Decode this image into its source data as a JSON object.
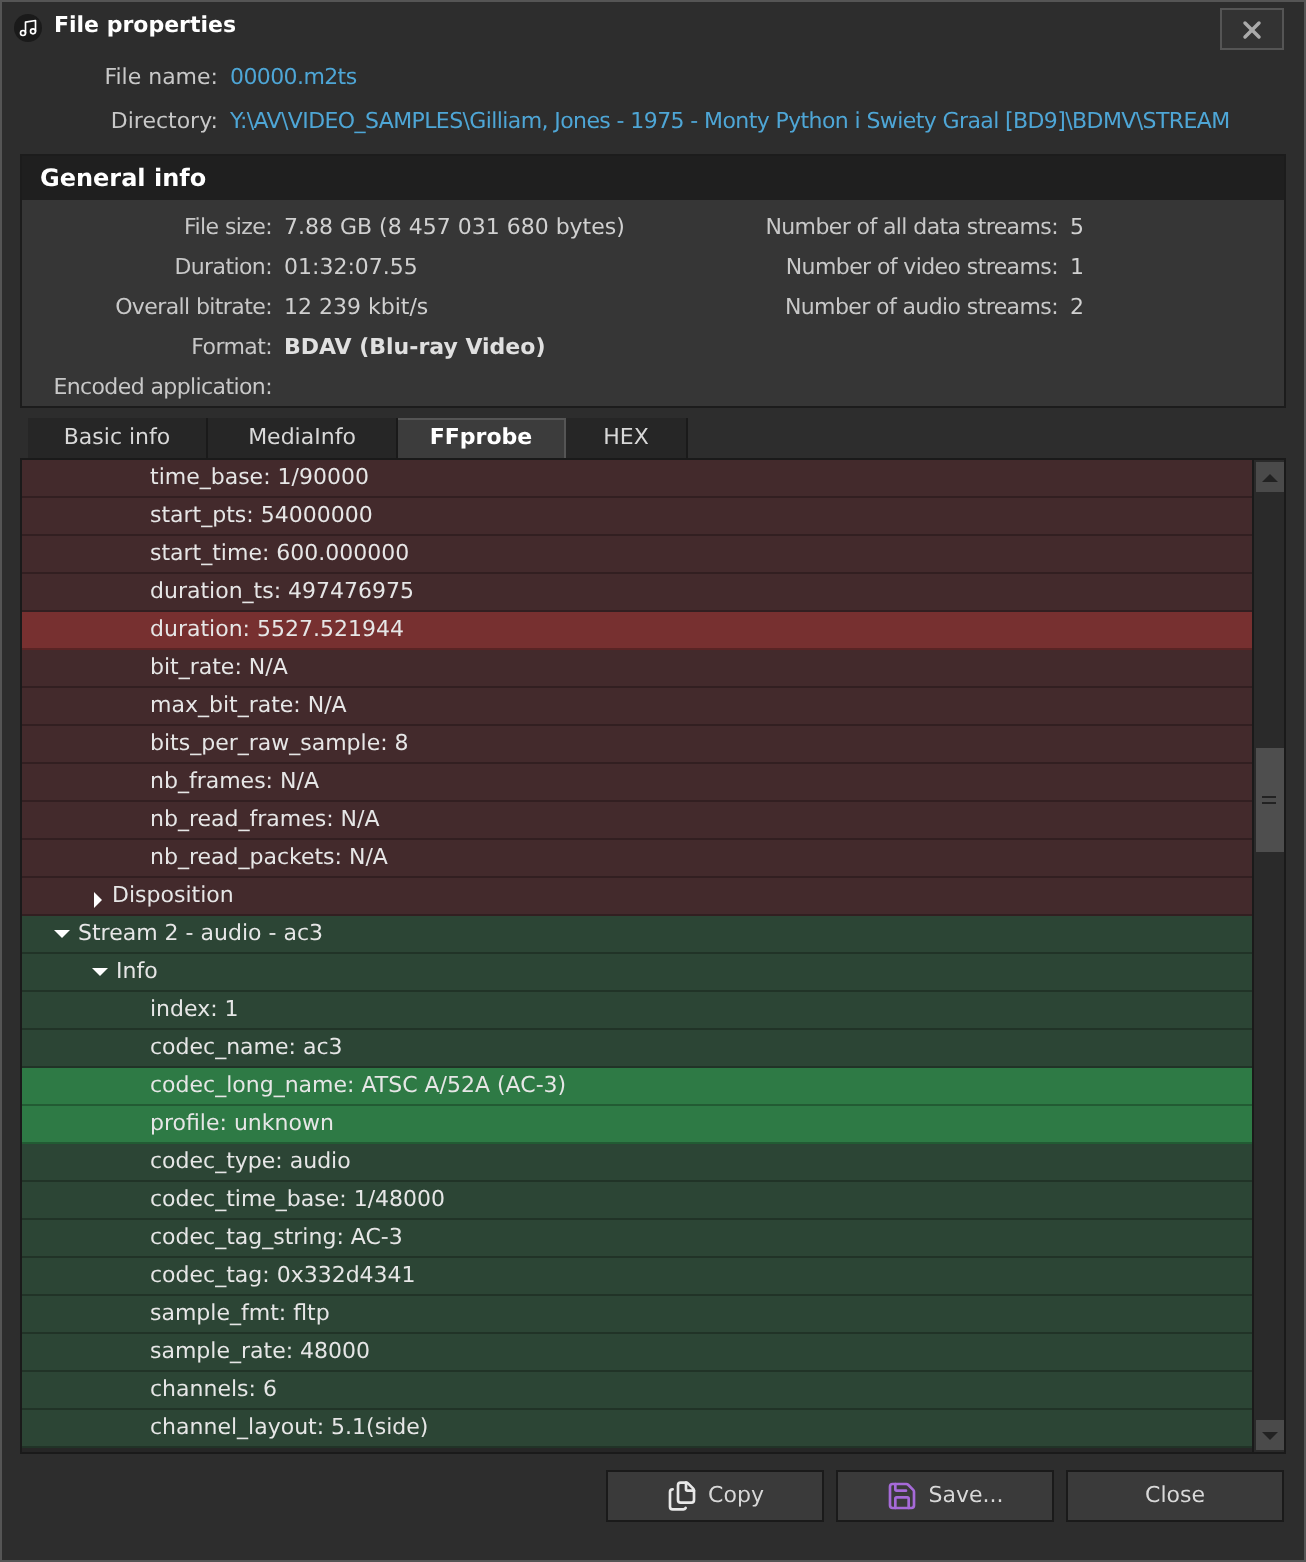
{
  "window": {
    "title": "File properties"
  },
  "file": [
    {
      "label": "File name:",
      "value": "00000.m2ts"
    },
    {
      "label": "Directory:",
      "value": "Y:\\AV\\VIDEO_SAMPLES\\Gilliam, Jones - 1975 - Monty Python i Swiety Graal [BD9]\\BDMV\\STREAM"
    }
  ],
  "general_info": {
    "title": "General info",
    "left": [
      {
        "label": "File size:",
        "value": "7.88 GB (8 457 031 680 bytes)",
        "bold": false
      },
      {
        "label": "Duration:",
        "value": "01:32:07.55",
        "bold": false
      },
      {
        "label": "Overall bitrate:",
        "value": "12 239 kbit/s",
        "bold": false
      },
      {
        "label": "Format:",
        "value": "BDAV (Blu-ray Video)",
        "bold": true
      },
      {
        "label": "Encoded application:"
      }
    ],
    "right": [
      {
        "label": "Number of all data streams:",
        "value": "5"
      },
      {
        "label": "Number of video streams:",
        "value": "1"
      },
      {
        "label": "Number of audio streams:",
        "value": "2"
      }
    ]
  },
  "tabs": [
    {
      "label": "Basic info",
      "selected": false
    },
    {
      "label": "MediaInfo",
      "selected": false
    },
    {
      "label": "FFprobe",
      "selected": true
    },
    {
      "label": "HEX",
      "selected": false
    }
  ],
  "tree": [
    {
      "color": "#432a2c",
      "children": [
        {
          "children": [
            {
              "label": "time_base: 1/90000",
              "selected": false
            },
            {
              "label": "start_pts: 54000000",
              "selected": false
            },
            {
              "label": "start_time: 600.000000",
              "selected": false
            },
            {
              "label": "duration_ts: 497476975",
              "selected": false
            },
            {
              "label": "duration: 5527.521944",
              "selected": true
            },
            {
              "label": "bit_rate: N/A",
              "selected": false
            },
            {
              "label": "max_bit_rate: N/A",
              "selected": false
            },
            {
              "label": "bits_per_raw_sample: 8",
              "selected": false
            },
            {
              "label": "nb_frames: N/A",
              "selected": false
            },
            {
              "label": "nb_read_frames: N/A",
              "selected": false
            },
            {
              "label": "nb_read_packets: N/A",
              "selected": false
            }
          ]
        },
        {
          "label": "Disposition",
          "expanded": false,
          "selected": false
        }
      ]
    },
    {
      "label": "Stream 2 - audio - ac3",
      "expanded": true,
      "selected": false,
      "color": "#2c4535",
      "children": [
        {
          "label": "Info",
          "expanded": true,
          "selected": false,
          "children": [
            {
              "label": "index: 1",
              "selected": false
            },
            {
              "label": "codec_name: ac3",
              "selected": false
            },
            {
              "label": "codec_long_name: ATSC A/52A (AC-3)",
              "selected": true
            },
            {
              "label": "profile: unknown",
              "selected": true
            },
            {
              "label": "codec_type: audio",
              "selected": false
            },
            {
              "label": "codec_time_base: 1/48000",
              "selected": false
            },
            {
              "label": "codec_tag_string: AC-3",
              "selected": false
            },
            {
              "label": "codec_tag: 0x332d4341",
              "selected": false
            },
            {
              "label": "sample_fmt: fltp",
              "selected": false
            },
            {
              "label": "sample_rate: 48000",
              "selected": false
            },
            {
              "label": "channels: 6",
              "selected": false
            },
            {
              "label": "channel_layout: 5.1(side)",
              "selected": false
            }
          ]
        }
      ]
    }
  ],
  "buttons": [
    {
      "kind": "copy",
      "label": "Copy"
    },
    {
      "kind": "save",
      "label": "Save..."
    },
    {
      "kind": "close",
      "label": "Close"
    }
  ]
}
